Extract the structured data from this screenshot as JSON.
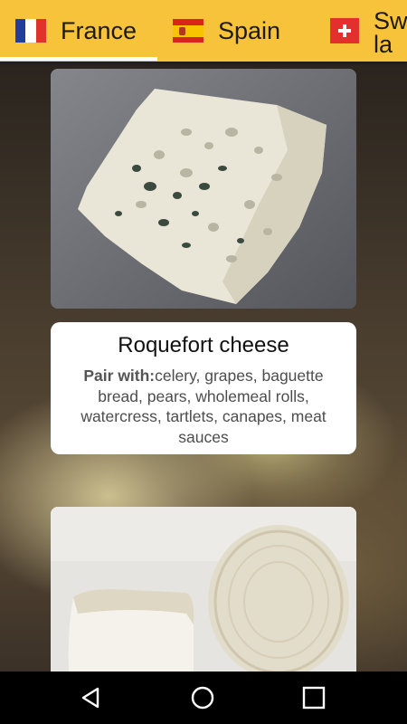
{
  "tabs": [
    {
      "label": "France",
      "flag": "france-flag"
    },
    {
      "label": "Spain",
      "flag": "spain-flag"
    },
    {
      "label": "Swi\nla",
      "flag": "switzerland-flag"
    }
  ],
  "colors": {
    "tabbar": "#f6c33a",
    "indicator": "#ffffff",
    "card": "#ffffff",
    "navbar": "#000000"
  },
  "cheese": {
    "title": "Roquefort cheese",
    "pair_label": "Pair with:",
    "pair_text": "celery, grapes, baguette bread, pears, wholemeal rolls, watercress, tartlets, canapes, meat sauces"
  },
  "navbar": {
    "icons": [
      "back-icon",
      "home-icon",
      "recents-icon"
    ]
  }
}
